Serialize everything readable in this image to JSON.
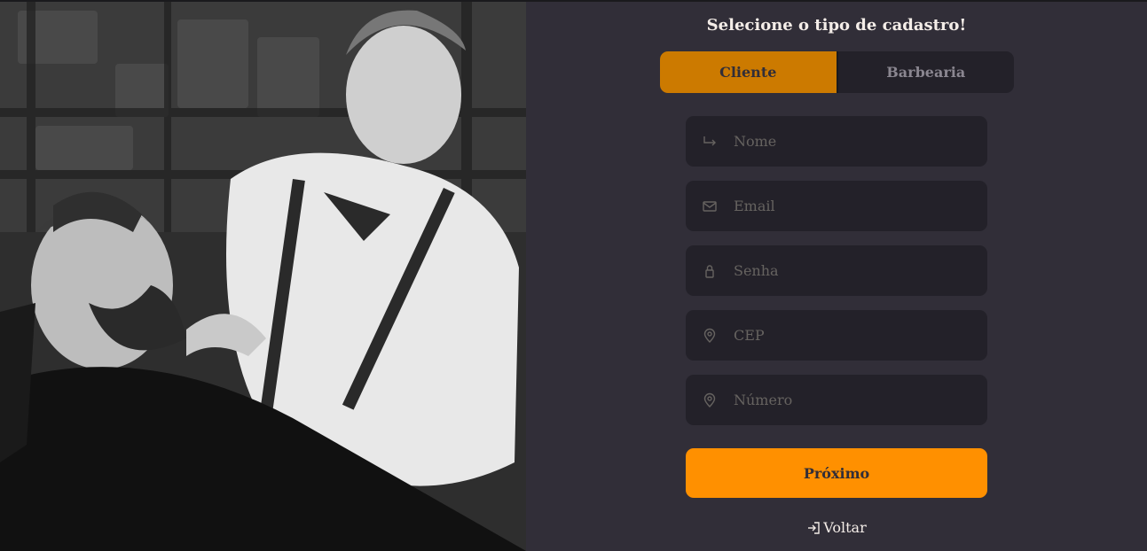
{
  "photo": {
    "alt": "barber-trimming-beard"
  },
  "form": {
    "title": "Selecione o tipo de cadastro!",
    "toggle": {
      "options": [
        "Cliente",
        "Barbearia"
      ],
      "selected": "Cliente"
    },
    "fields": [
      {
        "name": "name",
        "placeholder": "Nome",
        "icon": "arrow-return-icon",
        "value": ""
      },
      {
        "name": "email",
        "placeholder": "Email",
        "icon": "envelope-icon",
        "value": ""
      },
      {
        "name": "password",
        "placeholder": "Senha",
        "icon": "lock-icon",
        "value": ""
      },
      {
        "name": "cep",
        "placeholder": "CEP",
        "icon": "map-pin-icon",
        "value": ""
      },
      {
        "name": "number",
        "placeholder": "Número",
        "icon": "map-pin-icon",
        "value": ""
      }
    ],
    "next_label": "Próximo",
    "back_label": "Voltar",
    "back_icon": "log-in-icon"
  },
  "colors": {
    "background": "#312e38",
    "input_bg": "#232129",
    "accent": "#ff9000",
    "accent_selected": "#cc7a00",
    "text": "#f4ede8",
    "placeholder": "#666360"
  }
}
